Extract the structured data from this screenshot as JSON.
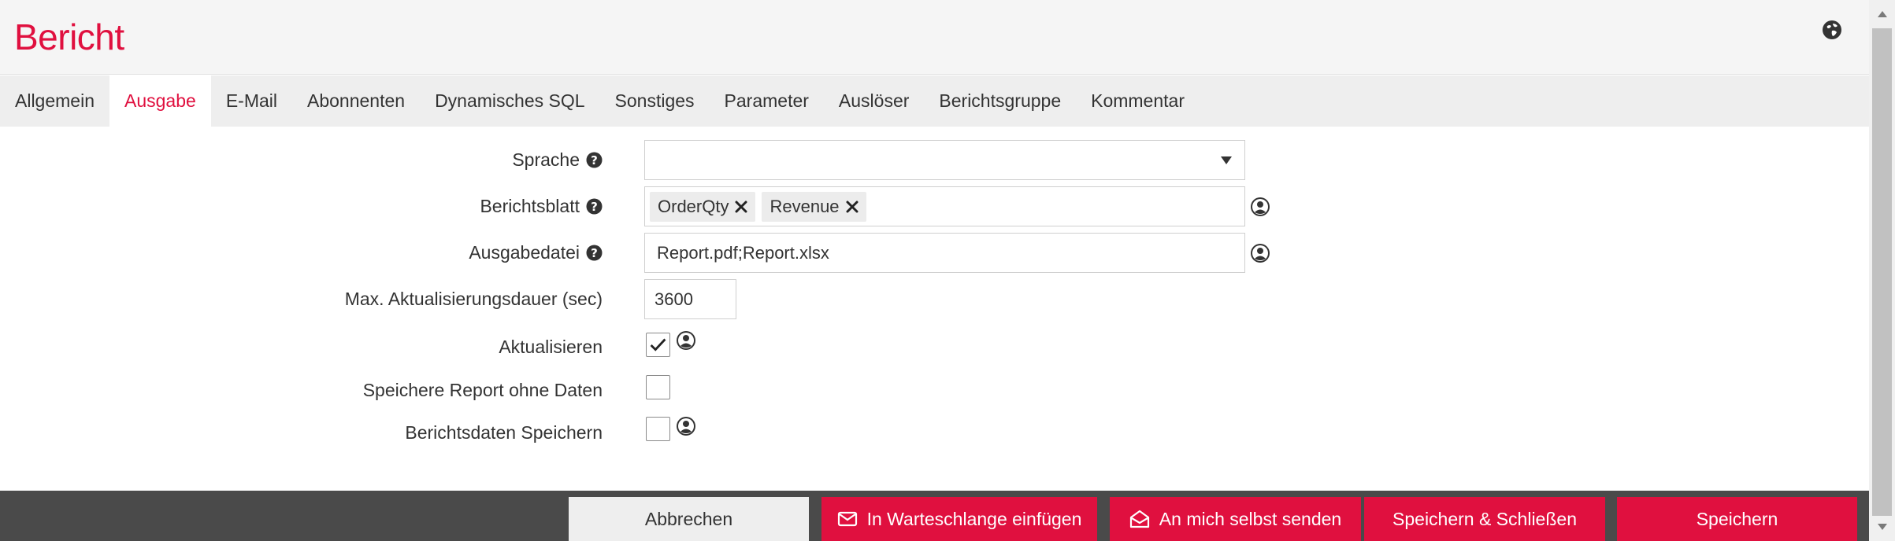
{
  "header": {
    "title": "Bericht",
    "globe_icon": "globe-icon"
  },
  "tabs": [
    {
      "label": "Allgemein",
      "active": false
    },
    {
      "label": "Ausgabe",
      "active": true
    },
    {
      "label": "E-Mail",
      "active": false
    },
    {
      "label": "Abonnenten",
      "active": false
    },
    {
      "label": "Dynamisches SQL",
      "active": false
    },
    {
      "label": "Sonstiges",
      "active": false
    },
    {
      "label": "Parameter",
      "active": false
    },
    {
      "label": "Auslöser",
      "active": false
    },
    {
      "label": "Berichtsgruppe",
      "active": false
    },
    {
      "label": "Kommentar",
      "active": false
    }
  ],
  "form": {
    "sprache": {
      "label": "Sprache",
      "value": ""
    },
    "berichtsblatt": {
      "label": "Berichtsblatt",
      "tags": [
        "OrderQty",
        "Revenue"
      ]
    },
    "ausgabedatei": {
      "label": "Ausgabedatei",
      "value": "Report.pdf;Report.xlsx"
    },
    "max_dauer": {
      "label": "Max. Aktualisierungsdauer (sec)",
      "value": "3600"
    },
    "aktualisieren": {
      "label": "Aktualisieren",
      "checked": true
    },
    "ohne_daten": {
      "label": "Speichere Report ohne Daten",
      "checked": false
    },
    "daten_speichern": {
      "label": "Berichtsdaten Speichern",
      "checked": false
    }
  },
  "footer": {
    "cancel": "Abbrechen",
    "queue": "In Warteschlange einfügen",
    "send_self": "An mich selbst senden",
    "save_close": "Speichern & Schließen",
    "save": "Speichern"
  },
  "colors": {
    "accent": "#e0103f",
    "footer_bg": "#4a4a4a",
    "tab_bg": "#eeeeee"
  }
}
